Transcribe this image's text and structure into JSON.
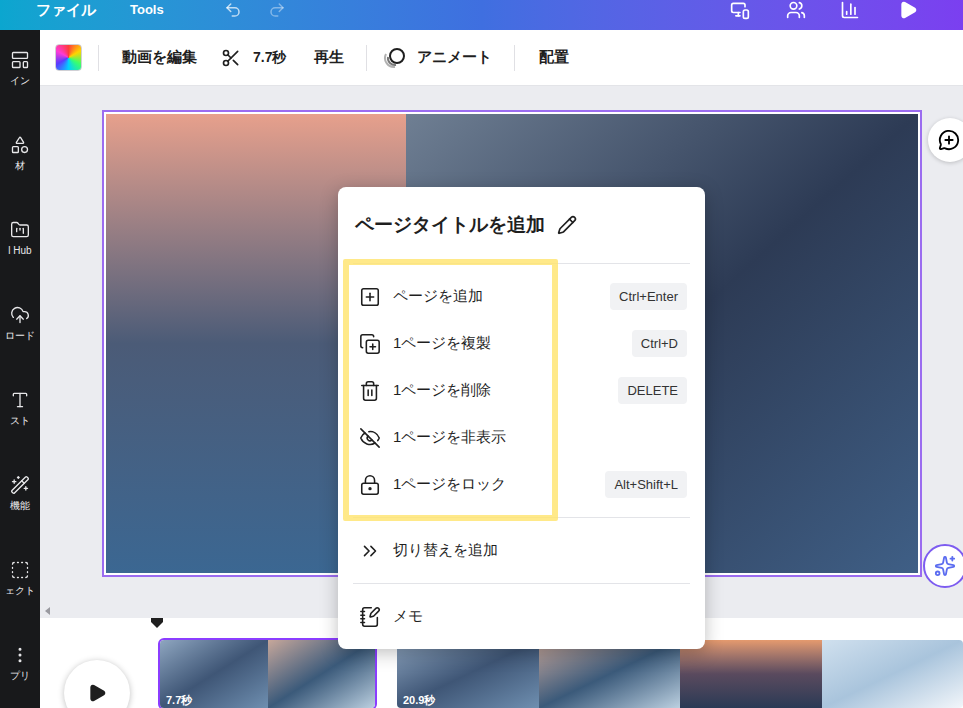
{
  "topbar": {
    "menu": [
      "ファイル",
      "Tools"
    ]
  },
  "sidebar": {
    "items": [
      "イン",
      "材",
      "l Hub",
      "ロード",
      "スト",
      "機能",
      "ェクト",
      "プリ"
    ]
  },
  "toolbar": {
    "edit_video": "動画を編集",
    "duration": "7.7秒",
    "play": "再生",
    "animate": "アニメート",
    "position": "配置"
  },
  "context_menu": {
    "title": "ページタイトルを追加",
    "groups": [
      [
        {
          "label": "ページを追加",
          "shortcut": "Ctrl+Enter",
          "highlighted": true
        },
        {
          "label": "1ページを複製",
          "shortcut": "Ctrl+D",
          "highlighted": true
        },
        {
          "label": "1ページを削除",
          "shortcut": "DELETE",
          "highlighted": true
        },
        {
          "label": "1ページを非表示",
          "shortcut": "",
          "highlighted": true
        },
        {
          "label": "1ページをロック",
          "shortcut": "Alt+Shift+L",
          "highlighted": true
        }
      ],
      [
        {
          "label": "切り替えを追加",
          "shortcut": "",
          "highlighted": false
        }
      ],
      [
        {
          "label": "メモ",
          "shortcut": "",
          "highlighted": false
        }
      ]
    ]
  },
  "timeline": {
    "clips": [
      {
        "duration": "7.7秒",
        "selected": true
      },
      {
        "duration": "20.9秒",
        "selected": false
      }
    ]
  }
}
